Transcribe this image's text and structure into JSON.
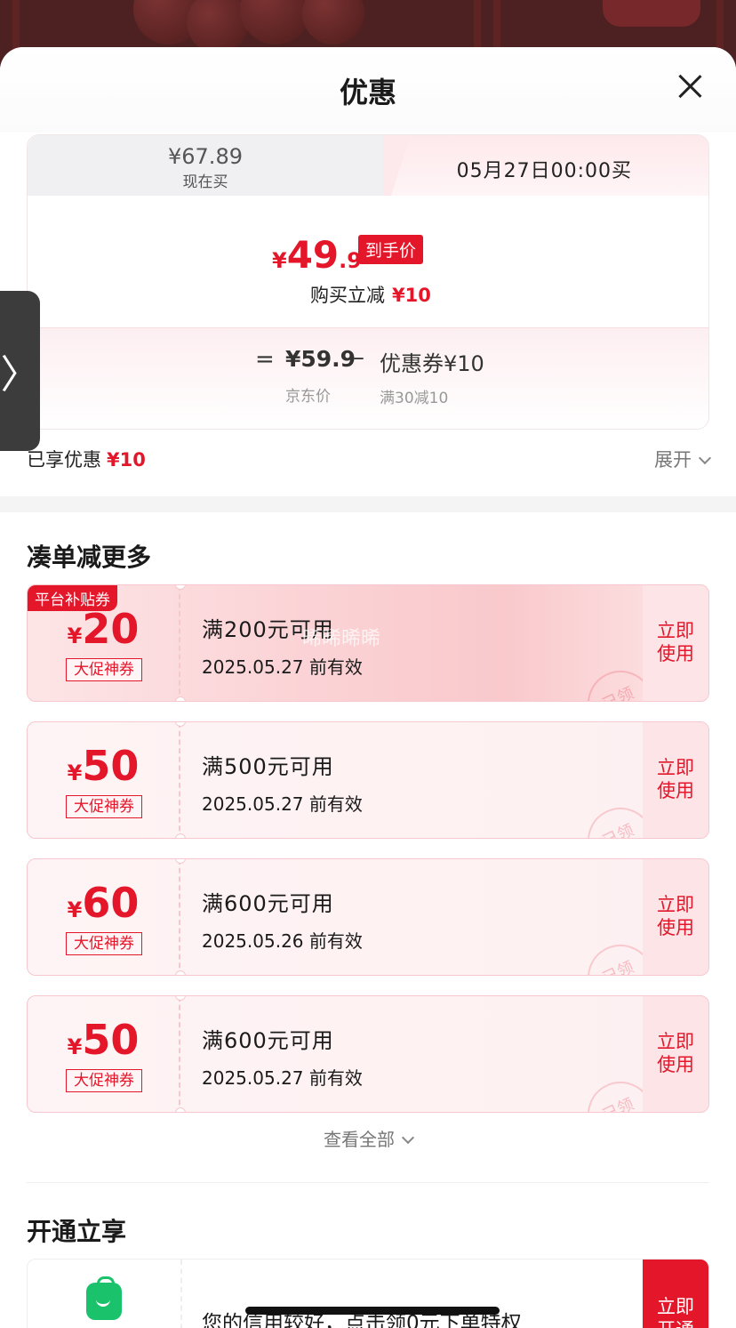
{
  "sheet": {
    "title": "优惠"
  },
  "price_tabs": {
    "now": {
      "price": "¥67.89",
      "label": "现在买"
    },
    "later": {
      "label": "05月27日00:00买"
    }
  },
  "final": {
    "yen": "¥",
    "int": "49",
    "dec": ".9",
    "badge": "到手价",
    "reduce_label": "购买立减",
    "reduce_amount": "¥10"
  },
  "formula": {
    "eq": "=",
    "jd_price": "¥59.9",
    "minus": "–",
    "coupon": "优惠券¥10",
    "jd_label": "京东价",
    "coupon_rule": "满30减10"
  },
  "summary": {
    "enjoyed_label": "已享优惠",
    "enjoyed_amount": "¥10",
    "expand_label": "展开"
  },
  "section_more": {
    "title": "凑单减更多"
  },
  "coupons": [
    {
      "badge": "平台补贴券",
      "yen": "¥",
      "amount": "20",
      "tag": "大促神券",
      "condition": "满200元可用",
      "validity": "2025.05.27 前有效",
      "stamp": "已领",
      "action": "立即\n使用"
    },
    {
      "badge": "",
      "yen": "¥",
      "amount": "50",
      "tag": "大促神券",
      "condition": "满500元可用",
      "validity": "2025.05.27 前有效",
      "stamp": "已领",
      "action": "立即\n使用"
    },
    {
      "badge": "",
      "yen": "¥",
      "amount": "60",
      "tag": "大促神券",
      "condition": "满600元可用",
      "validity": "2025.05.26 前有效",
      "stamp": "已领",
      "action": "立即\n使用"
    },
    {
      "badge": "",
      "yen": "¥",
      "amount": "50",
      "tag": "大促神券",
      "condition": "满600元可用",
      "validity": "2025.05.27 前有效",
      "stamp": "已领",
      "action": "立即\n使用"
    }
  ],
  "view_all": {
    "label": "查看全部"
  },
  "section_open": {
    "title": "开通立享"
  },
  "open_card": {
    "text": "您的信用较好，点击领0元下单特权",
    "action": "立即开通"
  },
  "watermark": "晞晞晞晞",
  "colors": {
    "accent": "#e3162a",
    "coupon_border": "#f6c7cc",
    "bag_icon": "#19c26b"
  },
  "icons": {
    "close": "close-icon",
    "chevron": "chevron-down-icon",
    "side": "chevron-right-icon",
    "bag": "shopping-bag-icon"
  }
}
